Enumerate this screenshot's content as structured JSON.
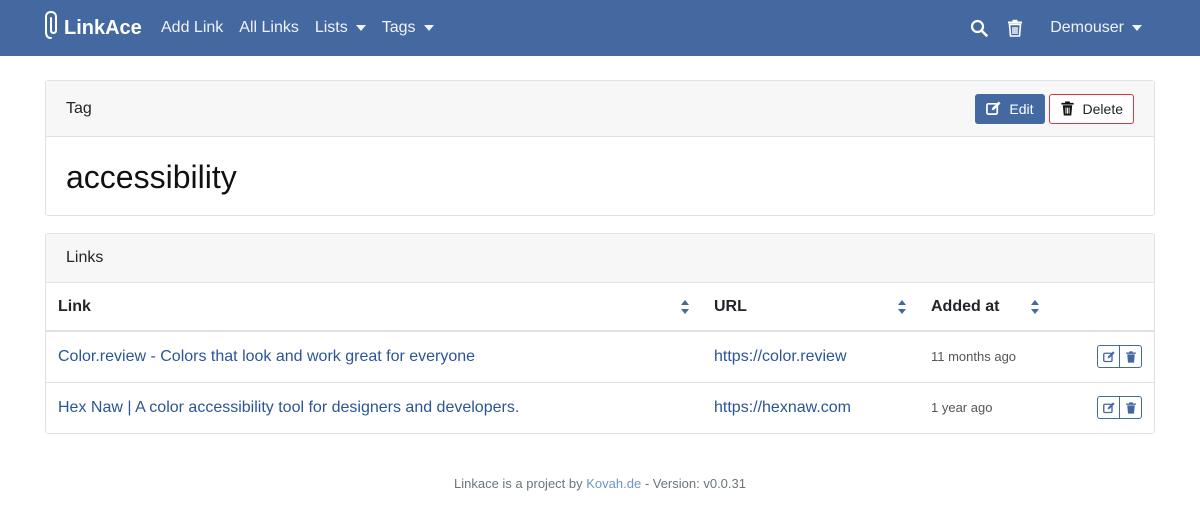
{
  "navbar": {
    "brand": "LinkAce",
    "links": [
      {
        "label": "Add Link"
      },
      {
        "label": "All Links"
      },
      {
        "label": "Lists",
        "dropdown": true
      },
      {
        "label": "Tags",
        "dropdown": true
      }
    ],
    "icons": [
      "search-icon",
      "trash-icon"
    ],
    "user": "Demouser"
  },
  "tag_card": {
    "header": "Tag",
    "edit_label": "Edit",
    "delete_label": "Delete",
    "tag_name": "accessibility"
  },
  "links_card": {
    "header": "Links",
    "columns": [
      "Link",
      "URL",
      "Added at"
    ],
    "rows": [
      {
        "title": "Color.review - Colors that look and work great for everyone",
        "url": "https://color.review",
        "added": "11 months ago"
      },
      {
        "title": "Hex Naw | A color accessibility tool for designers and developers.",
        "url": "https://hexnaw.com",
        "added": "1 year ago"
      }
    ]
  },
  "footer": {
    "prefix": "Linkace is a project by",
    "author": "Kovah.de",
    "version": "- Version: v0.0.31"
  },
  "colors": {
    "navbar": "#4468a0",
    "link": "#2b5597",
    "danger": "#dc3545"
  }
}
